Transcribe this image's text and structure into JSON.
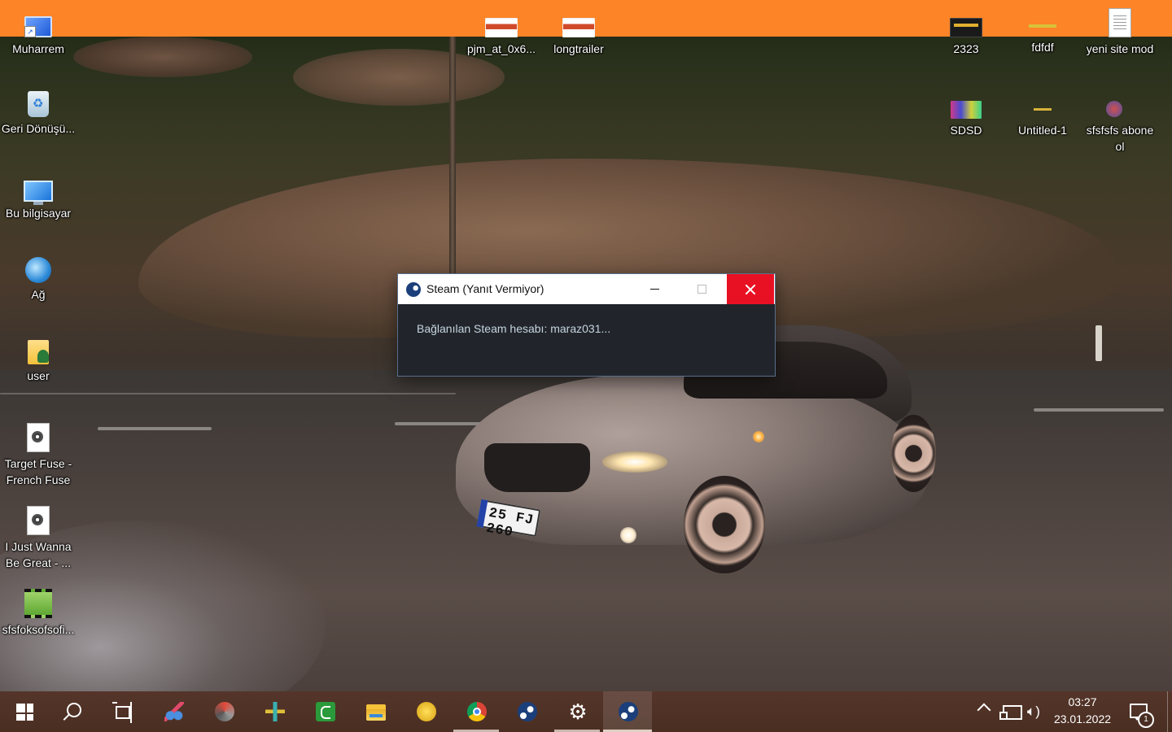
{
  "desktop": {
    "left_icons": [
      {
        "label": "Muharrem",
        "icon": "monitor-shortcut-icon"
      },
      {
        "label": "Geri Dönüşü...",
        "icon": "recycle-bin-icon"
      },
      {
        "label": "Bu bilgisayar",
        "icon": "computer-icon"
      },
      {
        "label": "Ağ",
        "icon": "network-icon"
      },
      {
        "label": "user",
        "icon": "user-folder-icon"
      },
      {
        "label": "Target Fuse - French Fuse",
        "icon": "audio-file-icon"
      },
      {
        "label": "I Just Wanna Be Great - ...",
        "icon": "audio-file-icon"
      },
      {
        "label": "sfsfoksofsofi...",
        "icon": "video-file-icon"
      }
    ],
    "top_icons": [
      {
        "label": "pjm_at_0x6...",
        "icon": "image-thumbnail-icon"
      },
      {
        "label": "longtrailer",
        "icon": "image-thumbnail-icon"
      }
    ],
    "right_icons": [
      {
        "label": "2323",
        "icon": "image-thumbnail-icon"
      },
      {
        "label": "fdfdf",
        "icon": "image-thumbnail-icon"
      },
      {
        "label": "yeni site mod",
        "icon": "text-document-icon"
      },
      {
        "label": "SDSD",
        "icon": "image-thumbnail-icon"
      },
      {
        "label": "Untitled-1",
        "icon": "image-thumbnail-icon"
      },
      {
        "label": "sfsfsfs abone ol",
        "icon": "image-thumbnail-icon"
      }
    ],
    "wallpaper_plate": "25 FJ 260"
  },
  "dialog": {
    "title": "Steam (Yanıt Vermiyor)",
    "message": "Bağlanılan Steam hesabı: maraz031...",
    "icon": "steam-icon",
    "close_color": "#e81123"
  },
  "taskbar": {
    "pinned": [
      {
        "name": "start",
        "icon": "windows-logo-icon"
      },
      {
        "name": "search",
        "icon": "search-icon"
      },
      {
        "name": "task-view",
        "icon": "task-view-icon"
      },
      {
        "name": "snipping-tool",
        "icon": "scissors-icon"
      },
      {
        "name": "photoscape",
        "icon": "spiral-app-icon"
      },
      {
        "name": "flight-app",
        "icon": "plane-app-icon"
      },
      {
        "name": "camtasia",
        "icon": "green-app-icon"
      },
      {
        "name": "file-explorer",
        "icon": "folder-icon"
      },
      {
        "name": "yellow-app",
        "icon": "yellow-app-icon"
      },
      {
        "name": "chrome",
        "icon": "chrome-icon"
      },
      {
        "name": "steam",
        "icon": "steam-icon"
      },
      {
        "name": "settings",
        "icon": "gear-icon"
      },
      {
        "name": "steam-active",
        "icon": "steam-icon"
      }
    ],
    "clock_time": "03:27",
    "clock_date": "23.01.2022",
    "notification_count": "1",
    "color": "#4a2e22"
  }
}
